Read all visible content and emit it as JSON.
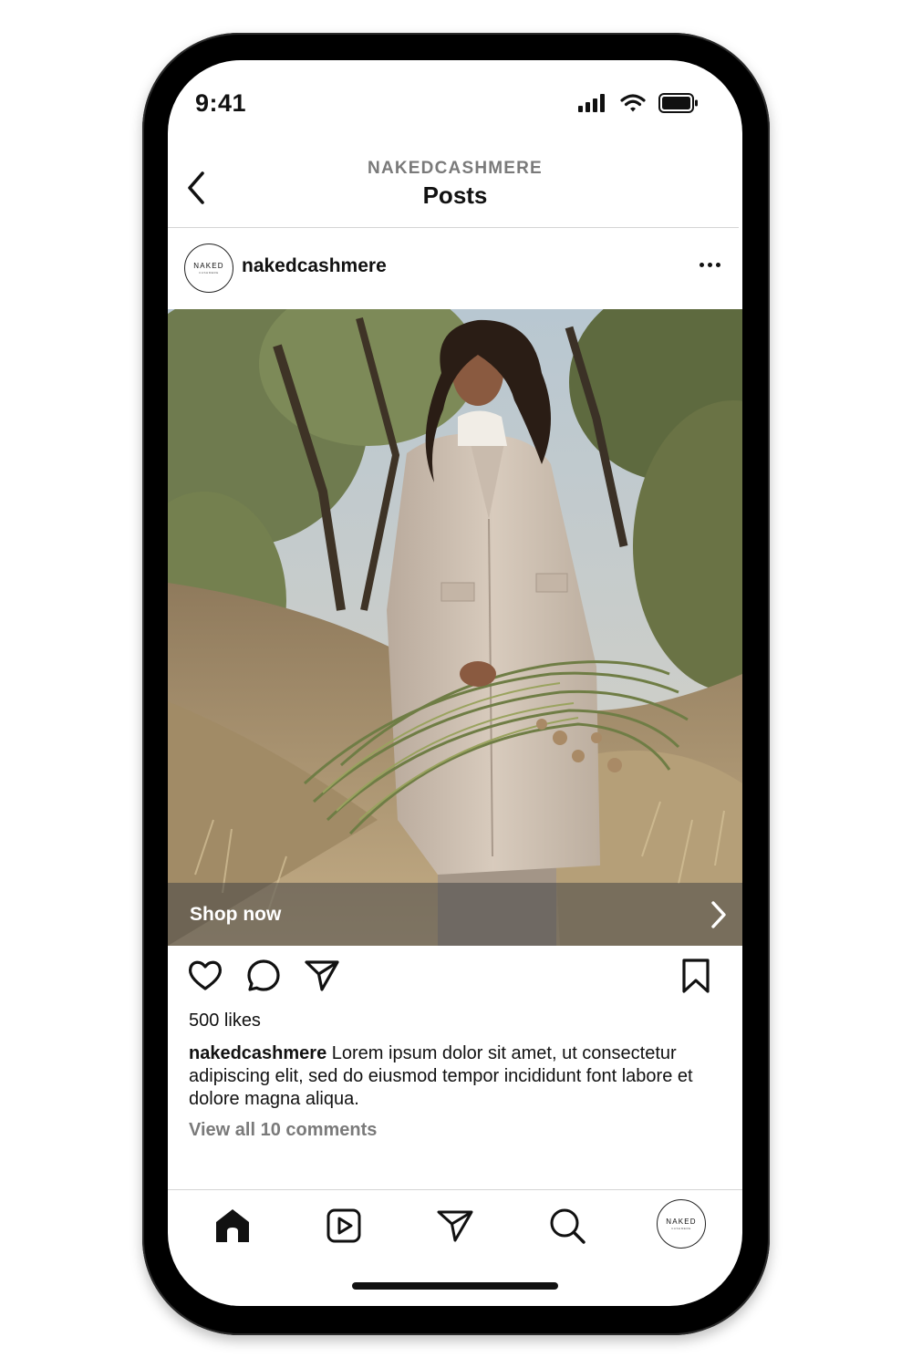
{
  "status_bar": {
    "time": "9:41",
    "icons": [
      "signal-bars-icon",
      "wifi-icon",
      "battery-icon"
    ]
  },
  "header": {
    "account_name": "NAKEDCASHMERE",
    "title": "Posts",
    "back_icon": "chevron-left-icon"
  },
  "post": {
    "avatar_logo_text": "NAKED",
    "avatar_logo_subtext": "CASHMERE",
    "username": "nakedcashmere",
    "more_icon": "ellipsis-icon",
    "image_alt": "Woman in a beige cashmere coat holding a bundle of dried grasses on a sunny hillside",
    "shop_label": "Shop now",
    "likes": "500 likes",
    "caption_user": "nakedcashmere",
    "caption_text": " Lorem ipsum dolor sit amet, ut consectetur adipiscing elit, sed do eiusmod tempor incididunt font labore et dolore magna aliqua.",
    "view_comments": "View all 10 comments",
    "actions": [
      "heart-icon",
      "comment-icon",
      "share-icon",
      "bookmark-icon"
    ]
  },
  "bottom_nav": {
    "items": [
      "home-icon",
      "reels-icon",
      "direct-message-icon",
      "search-icon",
      "profile-avatar"
    ],
    "profile_logo_text": "NAKED",
    "profile_logo_subtext": "CASHMERE"
  },
  "colors": {
    "frame": "#000000",
    "text_primary": "#111111",
    "text_secondary": "#7a7a7a",
    "divider": "#d4d4d4",
    "shop_bar": "#464646"
  }
}
